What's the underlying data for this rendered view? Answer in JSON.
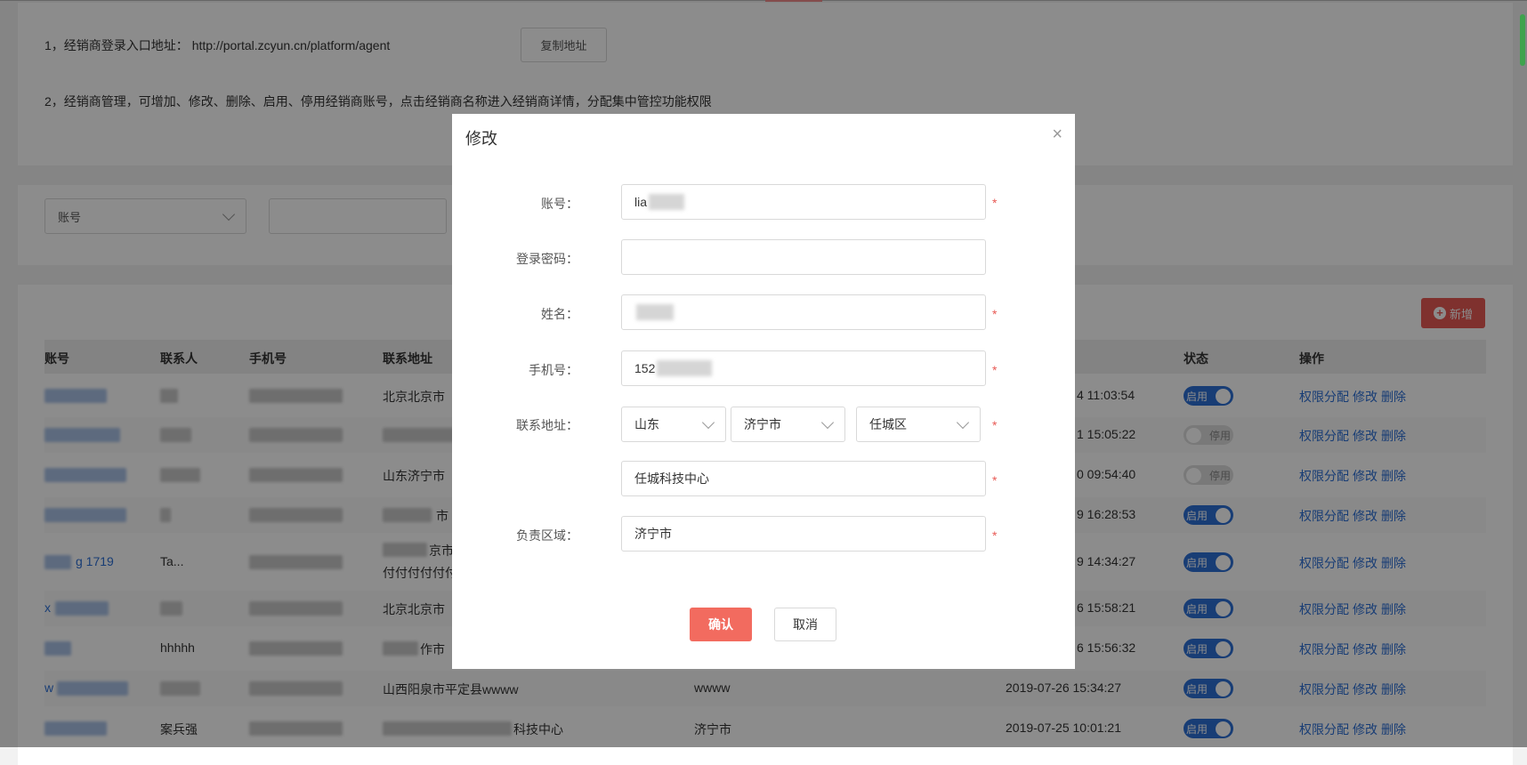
{
  "info": {
    "line1_prefix": "1，经销商登录入口地址：",
    "line1_url": "http://portal.zcyun.cn/platform/agent",
    "copy_button": "复制地址",
    "line2": "2，经销商管理，可增加、修改、删除、启用、停用经销商账号，点击经销商名称进入经销商详情，分配集中管控功能权限"
  },
  "filter": {
    "select_value": "账号"
  },
  "add_button": "新增",
  "table": {
    "headers": [
      "账号",
      "联系人",
      "手机号",
      "联系地址",
      "状态",
      "操作"
    ],
    "rows": [
      {
        "address": "北京北京市",
        "region": "",
        "time": "4 11:03:54",
        "status": "启用"
      },
      {
        "address": "",
        "region": "",
        "time": "1 15:05:22",
        "status": "停用"
      },
      {
        "address": "山东济宁市",
        "region": "",
        "time": "0 09:54:40",
        "status": "停用"
      },
      {
        "address": "市",
        "region": "",
        "time": "9 16:28:53",
        "status": "启用"
      },
      {
        "account": "g 1719",
        "contact": "Ta...",
        "address": "京市",
        "address2": "付付付付付付",
        "region": "",
        "time": "9 14:34:27",
        "status": "启用"
      },
      {
        "account": "x",
        "address": "北京北京市",
        "region": "",
        "time": "6 15:58:21",
        "status": "启用"
      },
      {
        "contact": "hhhhh",
        "address": "作市",
        "region": "",
        "time": "6 15:56:32",
        "status": "启用"
      },
      {
        "account": "w",
        "address": "山西阳泉市平定县wwww",
        "region": "wwww",
        "time": "2019-07-26 15:34:27",
        "status": "启用"
      },
      {
        "contact": "案兵强",
        "address": "科技中心",
        "region": "济宁市",
        "time": "2019-07-25 10:01:21",
        "status": "启用"
      }
    ],
    "ops": [
      "权限分配",
      "修改",
      "删除"
    ]
  },
  "modal": {
    "title": "修改",
    "close": "×",
    "labels": {
      "account": "账号：",
      "password": "登录密码：",
      "name": "姓名：",
      "phone": "手机号：",
      "address": "联系地址：",
      "region": "负责区域："
    },
    "values": {
      "account": "lia",
      "password": "",
      "phone": "152",
      "province": "山东",
      "city": "济宁市",
      "district": "任城区",
      "address_detail": "任城科技中心",
      "region": "济宁市"
    },
    "required_mark": "*",
    "confirm": "确认",
    "cancel": "取消"
  },
  "colors": {
    "accent": "#2d6fd6",
    "danger": "#e85a55",
    "confirm": "#f26b5f"
  }
}
